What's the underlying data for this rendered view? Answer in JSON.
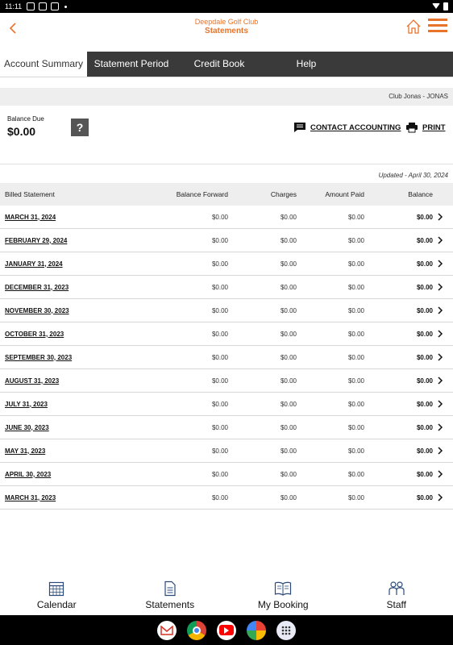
{
  "status_bar": {
    "time": "11:11"
  },
  "header": {
    "club_name": "Deepdale Golf Club",
    "title": "Statements"
  },
  "tabs": [
    {
      "label": "Account Summary",
      "active": true
    },
    {
      "label": "Statement Period",
      "active": false
    },
    {
      "label": "Credit Book",
      "active": false
    },
    {
      "label": "Help",
      "active": false
    }
  ],
  "club_bar": {
    "text": "Club Jonas - JONAS"
  },
  "balance": {
    "label": "Balance Due",
    "value": "$0.00",
    "help_symbol": "?"
  },
  "actions": {
    "contact": "CONTACT ACCOUNTING",
    "print": "PRINT"
  },
  "updated": "Updated - April 30, 2024",
  "table": {
    "headers": [
      "Billed Statement",
      "Balance Forward",
      "Charges",
      "Amount Paid",
      "Balance"
    ],
    "rows": [
      {
        "date": "MARCH 31, 2024",
        "forward": "$0.00",
        "charges": "$0.00",
        "paid": "$0.00",
        "balance": "$0.00"
      },
      {
        "date": "FEBRUARY 29, 2024",
        "forward": "$0.00",
        "charges": "$0.00",
        "paid": "$0.00",
        "balance": "$0.00"
      },
      {
        "date": "JANUARY 31, 2024",
        "forward": "$0.00",
        "charges": "$0.00",
        "paid": "$0.00",
        "balance": "$0.00"
      },
      {
        "date": "DECEMBER 31, 2023",
        "forward": "$0.00",
        "charges": "$0.00",
        "paid": "$0.00",
        "balance": "$0.00"
      },
      {
        "date": "NOVEMBER 30, 2023",
        "forward": "$0.00",
        "charges": "$0.00",
        "paid": "$0.00",
        "balance": "$0.00"
      },
      {
        "date": "OCTOBER 31, 2023",
        "forward": "$0.00",
        "charges": "$0.00",
        "paid": "$0.00",
        "balance": "$0.00"
      },
      {
        "date": "SEPTEMBER 30, 2023",
        "forward": "$0.00",
        "charges": "$0.00",
        "paid": "$0.00",
        "balance": "$0.00"
      },
      {
        "date": "AUGUST 31, 2023",
        "forward": "$0.00",
        "charges": "$0.00",
        "paid": "$0.00",
        "balance": "$0.00"
      },
      {
        "date": "JULY 31, 2023",
        "forward": "$0.00",
        "charges": "$0.00",
        "paid": "$0.00",
        "balance": "$0.00"
      },
      {
        "date": "JUNE 30, 2023",
        "forward": "$0.00",
        "charges": "$0.00",
        "paid": "$0.00",
        "balance": "$0.00"
      },
      {
        "date": "MAY 31, 2023",
        "forward": "$0.00",
        "charges": "$0.00",
        "paid": "$0.00",
        "balance": "$0.00"
      },
      {
        "date": "APRIL 30, 2023",
        "forward": "$0.00",
        "charges": "$0.00",
        "paid": "$0.00",
        "balance": "$0.00"
      },
      {
        "date": "MARCH 31, 2023",
        "forward": "$0.00",
        "charges": "$0.00",
        "paid": "$0.00",
        "balance": "$0.00"
      }
    ]
  },
  "bottom_nav": [
    {
      "label": "Calendar",
      "icon": "calendar-icon"
    },
    {
      "label": "Statements",
      "icon": "document-icon"
    },
    {
      "label": "My Booking",
      "icon": "book-icon"
    },
    {
      "label": "Staff",
      "icon": "people-icon"
    }
  ],
  "system_apps": [
    "gmail-icon",
    "chrome-icon",
    "youtube-icon",
    "photos-icon",
    "app-drawer-icon"
  ],
  "colors": {
    "accent": "#e8732a",
    "tab_bar": "#3a3a3a"
  }
}
